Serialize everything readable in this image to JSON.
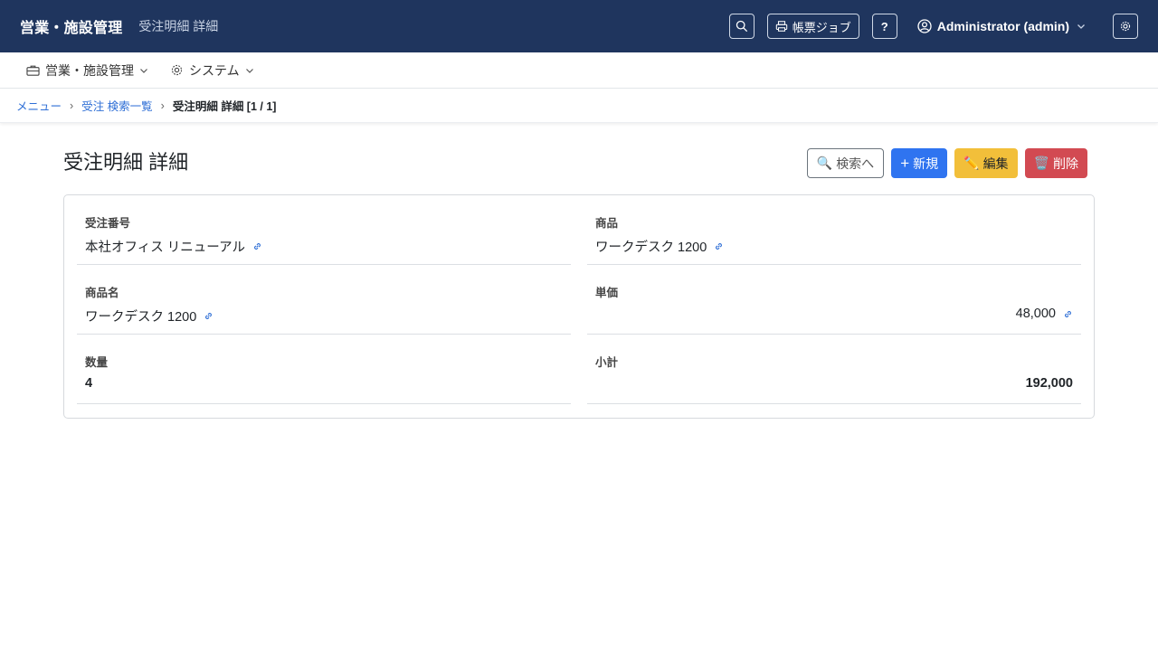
{
  "header": {
    "brand": "営業・施設管理",
    "subtitle": "受注明細 詳細",
    "job_label": "帳票ジョブ",
    "help_label": "?",
    "user_label": "Administrator (admin)"
  },
  "subnav": {
    "items": [
      {
        "label": "営業・施設管理",
        "icon": "briefcase-icon"
      },
      {
        "label": "システム",
        "icon": "gear-icon"
      }
    ]
  },
  "breadcrumb": {
    "items": [
      "メニュー",
      "受注 検索一覧"
    ],
    "current": "受注明細 詳細 [1 / 1]"
  },
  "page": {
    "title": "受注明細 詳細",
    "buttons": {
      "search": "検索へ",
      "new": "新規",
      "edit": "編集",
      "delete": "削除"
    }
  },
  "fields": [
    {
      "label": "受注番号",
      "value": "本社オフィス リニューアル",
      "link": true
    },
    {
      "label": "商品",
      "value": "ワークデスク 1200",
      "link": true
    },
    {
      "label": "商品名",
      "value": "ワークデスク 1200",
      "link": true
    },
    {
      "label": "単価",
      "value": "48,000",
      "link": true
    },
    {
      "label": "数量",
      "value": "4",
      "link": false
    },
    {
      "label": "小計",
      "value": "192,000",
      "link": false
    }
  ],
  "colors": {
    "navbar": "#1f355e",
    "primary": "#2f74f0",
    "warning": "#f2bf3a",
    "danger": "#d24a52",
    "link": "#2f6fd6"
  }
}
